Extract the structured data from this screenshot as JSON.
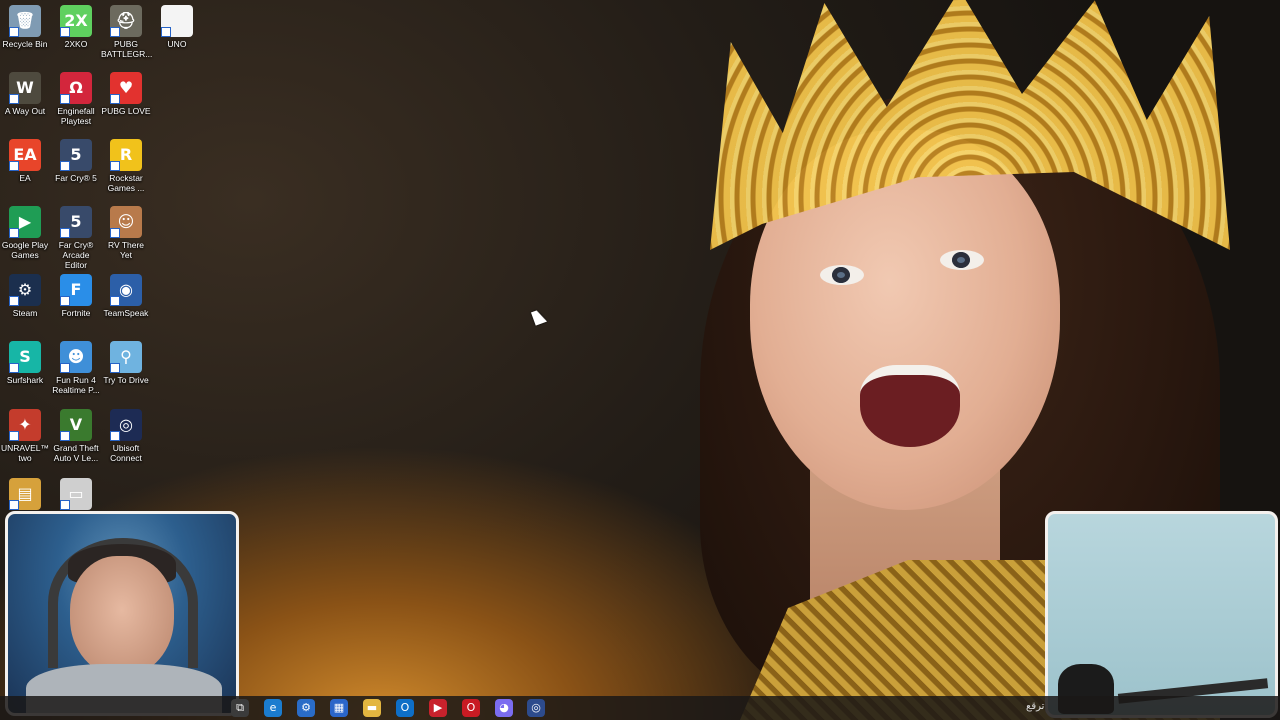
{
  "desktop": {
    "icons": [
      {
        "label": "Recycle Bin",
        "icon": "recycle-bin-icon",
        "color": "#7f9bb3",
        "glyph": "🗑"
      },
      {
        "label": "2XKO",
        "icon": "2xko-icon",
        "color": "#5fd05f",
        "glyph": "2X"
      },
      {
        "label": "PUBG BATTLEGR...",
        "icon": "pubg-battlegrounds-icon",
        "color": "#6c6a5e",
        "glyph": "⛑"
      },
      {
        "label": "UNO",
        "icon": "uno-file-icon",
        "color": "#f4f4f4",
        "glyph": ""
      },
      {
        "label": "A Way Out",
        "icon": "a-way-out-icon",
        "color": "#4e4a3e",
        "glyph": "W"
      },
      {
        "label": "Enginefall Playtest",
        "icon": "enginefall-icon",
        "color": "#d3263c",
        "glyph": "Ω"
      },
      {
        "label": "PUBG LOVE",
        "icon": "pubg-love-icon",
        "color": "#e2322f",
        "glyph": "♥"
      },
      {
        "label": "EA",
        "icon": "ea-icon",
        "color": "#e8452a",
        "glyph": "EA"
      },
      {
        "label": "Far Cry® 5",
        "icon": "far-cry-5-icon",
        "color": "#384a6a",
        "glyph": "5"
      },
      {
        "label": "Rockstar Games ...",
        "icon": "rockstar-games-icon",
        "color": "#f1c21b",
        "glyph": "R"
      },
      {
        "label": "Google Play Games",
        "icon": "google-play-games-icon",
        "color": "#1f9d55",
        "glyph": "▶"
      },
      {
        "label": "Far Cry® Arcade Editor",
        "icon": "far-cry-arcade-icon",
        "color": "#384a6a",
        "glyph": "5"
      },
      {
        "label": "RV There Yet",
        "icon": "rv-there-yet-icon",
        "color": "#b87a4b",
        "glyph": "☺"
      },
      {
        "label": "Steam",
        "icon": "steam-icon",
        "color": "#1b2f4e",
        "glyph": "⚙"
      },
      {
        "label": "Fortnite",
        "icon": "fortnite-icon",
        "color": "#2a8ee8",
        "glyph": "F"
      },
      {
        "label": "TeamSpeak",
        "icon": "teamspeak-icon",
        "color": "#2c5fa8",
        "glyph": "◉"
      },
      {
        "label": "Surfshark",
        "icon": "surfshark-icon",
        "color": "#17b6a6",
        "glyph": "S"
      },
      {
        "label": "Fun Run 4 Realtime P...",
        "icon": "fun-run-4-icon",
        "color": "#3f8fd8",
        "glyph": "☻"
      },
      {
        "label": "Try To Drive",
        "icon": "try-to-drive-icon",
        "color": "#6fb3e0",
        "glyph": "⚲"
      },
      {
        "label": "UNRAVEL™ two",
        "icon": "unravel-two-icon",
        "color": "#c43c2c",
        "glyph": "✦"
      },
      {
        "label": "Grand Theft Auto V Le...",
        "icon": "gta-v-icon",
        "color": "#3a7a2e",
        "glyph": "V"
      },
      {
        "label": "Ubisoft Connect",
        "icon": "ubisoft-connect-icon",
        "color": "#1d2b54",
        "glyph": "◎"
      },
      {
        "label": "",
        "icon": "folder-file-icon",
        "color": "#d6a13b",
        "glyph": "▤"
      },
      {
        "label": "",
        "icon": "drive-file-icon",
        "color": "#cfcfcf",
        "glyph": "▭"
      }
    ]
  },
  "taskbar": {
    "items": [
      {
        "icon": "task-view-icon",
        "color": "#3b3b3b",
        "glyph": "⧉"
      },
      {
        "icon": "edge-icon",
        "color": "#1b7ccf",
        "glyph": "e"
      },
      {
        "icon": "steam-taskbar-icon",
        "color": "#2a6cc7",
        "glyph": "⚙"
      },
      {
        "icon": "store-icon",
        "color": "#2b66c9",
        "glyph": "▦"
      },
      {
        "icon": "file-explorer-icon",
        "color": "#e3b640",
        "glyph": "▬"
      },
      {
        "icon": "outlook-icon",
        "color": "#0e6fc7",
        "glyph": "O"
      },
      {
        "icon": "video-editor-icon",
        "color": "#c8222c",
        "glyph": "▶"
      },
      {
        "icon": "opera-icon",
        "color": "#c81b23",
        "glyph": "O"
      },
      {
        "icon": "discord-icon",
        "color": "#7b6cf0",
        "glyph": "◕"
      },
      {
        "icon": "ubisoft-taskbar-icon",
        "color": "#2d4b8c",
        "glyph": "◎"
      }
    ],
    "tray_text": "ترقع"
  }
}
